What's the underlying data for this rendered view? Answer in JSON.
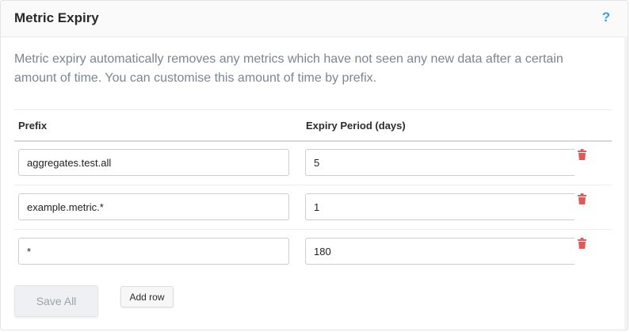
{
  "panel": {
    "title": "Metric Expiry",
    "help_label": "?",
    "description": "Metric expiry automatically removes any metrics which have not seen any new data after a certain amount of time. You can customise this amount of time by prefix."
  },
  "table": {
    "headers": {
      "prefix": "Prefix",
      "expiry": "Expiry Period (days)"
    },
    "rows": [
      {
        "prefix": "aggregates.test.all",
        "expiry": "5"
      },
      {
        "prefix": "example.metric.*",
        "expiry": "1"
      },
      {
        "prefix": "*",
        "expiry": "180"
      }
    ]
  },
  "actions": {
    "save_label": "Save All",
    "add_label": "Add row"
  },
  "colors": {
    "help_accent": "#3aa0e6",
    "delete_red": "#e05a5a"
  },
  "icons": {
    "help": "question-mark-icon",
    "delete": "trash-icon"
  }
}
